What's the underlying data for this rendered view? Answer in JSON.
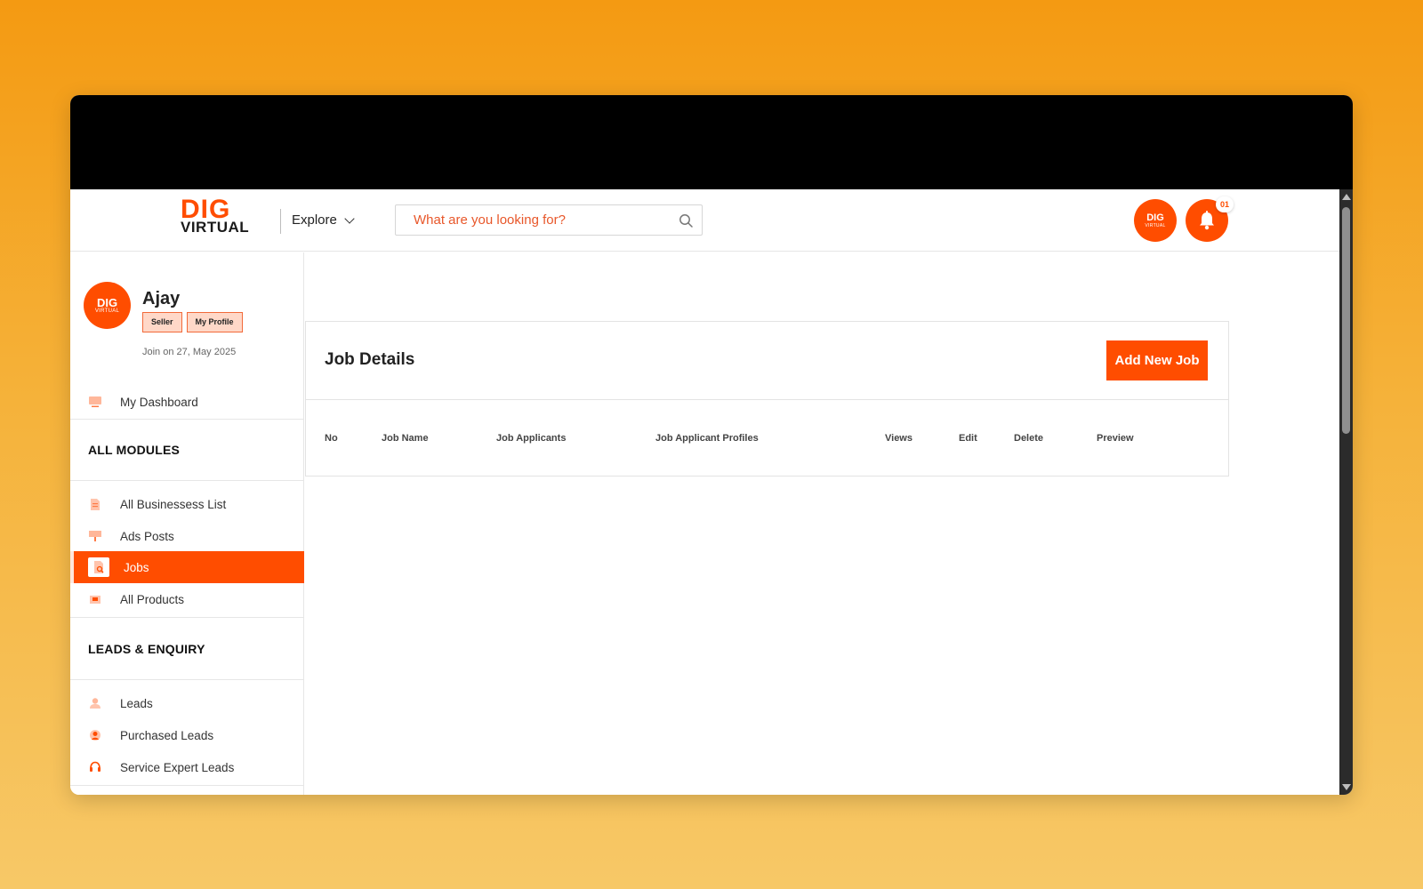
{
  "header": {
    "logo_top": "DIG",
    "logo_bottom": "VIRTUAL",
    "explore_label": "Explore",
    "search_placeholder": "What are you looking for?",
    "notification_count": "01",
    "avatar_logo_top": "DIG",
    "avatar_logo_bottom": "VIRTUAL"
  },
  "profile": {
    "avatar_logo_top": "DIG",
    "avatar_logo_bottom": "VIRTUAL",
    "name": "Ajay",
    "role_tag": "Seller",
    "profile_link": "My Profile",
    "join_date": "Join on 27, May 2025"
  },
  "sidebar": {
    "dashboard_label": "My Dashboard",
    "modules_title": "ALL MODULES",
    "modules": [
      {
        "label": "All Businessess List",
        "icon": "document-icon"
      },
      {
        "label": "Ads Posts",
        "icon": "billboard-icon"
      },
      {
        "label": "Jobs",
        "icon": "job-file-icon",
        "active": true
      },
      {
        "label": "All Products",
        "icon": "product-box-icon"
      }
    ],
    "leads_title": "LEADS & ENQUIRY",
    "leads": [
      {
        "label": "Leads",
        "icon": "user-icon"
      },
      {
        "label": "Purchased Leads",
        "icon": "purchased-user-icon"
      },
      {
        "label": "Service Expert Leads",
        "icon": "headset-icon"
      }
    ]
  },
  "main": {
    "title": "Job Details",
    "add_button": "Add New Job",
    "columns": [
      "No",
      "Job Name",
      "Job Applicants",
      "Job Applicant Profiles",
      "Views",
      "Edit",
      "Delete",
      "Preview"
    ]
  },
  "colors": {
    "accent": "#ff4d00",
    "tag_bg": "#ffd8c8",
    "placeholder": "#e8572a"
  }
}
